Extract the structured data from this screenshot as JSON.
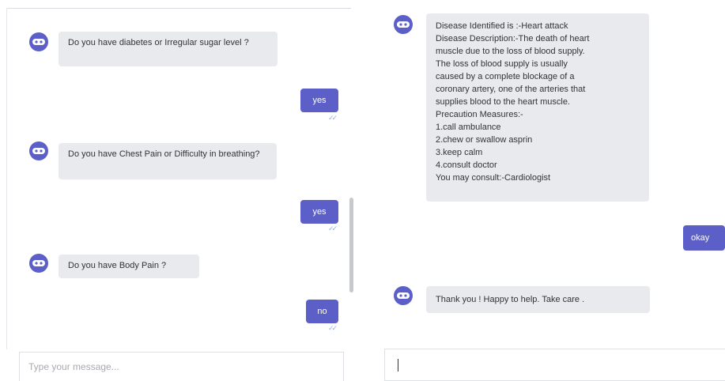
{
  "left_chat": {
    "messages": [
      {
        "from": "bot",
        "text": "Do you have  diabetes or Irregular sugar level ?"
      },
      {
        "from": "user",
        "text": "yes",
        "status": "✓✓"
      },
      {
        "from": "bot",
        "text": "Do you have Chest Pain or Difficulty in breathing?"
      },
      {
        "from": "user",
        "text": "yes",
        "status": "✓✓"
      },
      {
        "from": "bot",
        "text": "Do you have Body Pain ?"
      },
      {
        "from": "user",
        "text": "no",
        "status": "✓✓"
      }
    ],
    "input_placeholder": "Type your message..."
  },
  "right_chat": {
    "diagnosis_lines": [
      "Disease Identified is :-Heart attack",
      "Disease Description:-The death of heart",
      "muscle due to the loss of blood supply.",
      "The loss of blood supply is usually",
      "caused by a complete blockage of a",
      "coronary artery, one of the arteries that",
      "supplies blood to the heart muscle.",
      "Precaution Measures:-",
      "1.call ambulance",
      "2.chew or swallow asprin",
      "3.keep calm",
      "4.consult doctor",
      "You may consult:-Cardiologist"
    ],
    "user_reply": "okay",
    "closing_message": "Thank you ! Happy to help. Take care .",
    "input_value": ""
  },
  "colors": {
    "bot_icon": "#5b5fc7",
    "user_bubble": "#5b5fc7",
    "bot_bubble": "#e9eaee",
    "read_ticks": "#8ab4e8"
  }
}
